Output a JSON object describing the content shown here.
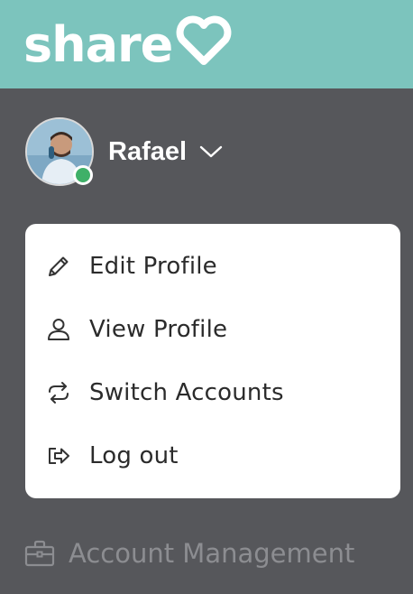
{
  "brand": {
    "logo_text": "share",
    "header_color": "#7cc4bd"
  },
  "user": {
    "name": "Rafael",
    "status": "online",
    "status_color": "#3fb068"
  },
  "menu": {
    "items": [
      {
        "label": "Edit Profile",
        "icon": "pencil-icon"
      },
      {
        "label": "View Profile",
        "icon": "user-icon"
      },
      {
        "label": "Switch Accounts",
        "icon": "switch-arrows-icon"
      },
      {
        "label": "Log out",
        "icon": "logout-icon"
      }
    ]
  },
  "sidebar": {
    "items": [
      {
        "label": "Account Management",
        "icon": "briefcase-icon"
      }
    ]
  }
}
